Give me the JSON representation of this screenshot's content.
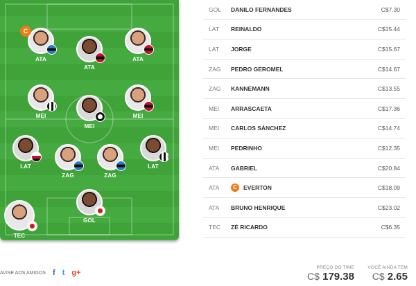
{
  "field": {
    "captain_marker": "C",
    "players": [
      {
        "pos": "ATA",
        "club": "gremio",
        "skin": "light"
      },
      {
        "pos": "ATA",
        "club": "flamengo",
        "skin": "dark"
      },
      {
        "pos": "ATA",
        "club": "flamengo",
        "skin": "light"
      },
      {
        "pos": "MEI",
        "club": "santos",
        "skin": "light"
      },
      {
        "pos": "MEI",
        "club": "corinthians",
        "skin": "dark"
      },
      {
        "pos": "MEI",
        "club": "flamengo",
        "skin": "light"
      },
      {
        "pos": "LAT",
        "club": "sao-paulo",
        "skin": "dark"
      },
      {
        "pos": "ZAG",
        "club": "gremio",
        "skin": "light"
      },
      {
        "pos": "ZAG",
        "club": "gremio",
        "skin": "light"
      },
      {
        "pos": "LAT",
        "club": "santos",
        "skin": "dark"
      },
      {
        "pos": "GOL",
        "club": "internacional",
        "skin": "dark"
      },
      {
        "pos": "TEC",
        "club": "internacional",
        "skin": "light"
      }
    ]
  },
  "roster": [
    {
      "pos": "GOL",
      "name": "DANILO FERNANDES",
      "price": "C$7.30",
      "captain": false
    },
    {
      "pos": "LAT",
      "name": "REINALDO",
      "price": "C$15.44",
      "captain": false
    },
    {
      "pos": "LAT",
      "name": "JORGE",
      "price": "C$15.67",
      "captain": false
    },
    {
      "pos": "ZAG",
      "name": "PEDRO GEROMEL",
      "price": "C$14.67",
      "captain": false
    },
    {
      "pos": "ZAG",
      "name": "KANNEMANN",
      "price": "C$13.55",
      "captain": false
    },
    {
      "pos": "MEI",
      "name": "ARRASCAETA",
      "price": "C$17.36",
      "captain": false
    },
    {
      "pos": "MEI",
      "name": "CARLOS SÁNCHEZ",
      "price": "C$14.74",
      "captain": false
    },
    {
      "pos": "MEI",
      "name": "PEDRINHO",
      "price": "C$12.35",
      "captain": false
    },
    {
      "pos": "ATA",
      "name": "GABRIEL",
      "price": "C$20.84",
      "captain": false
    },
    {
      "pos": "ATA",
      "name": "EVERTON",
      "price": "C$18.09",
      "captain": true
    },
    {
      "pos": "ATA",
      "name": "BRUNO HENRIQUE",
      "price": "C$23.02",
      "captain": false
    },
    {
      "pos": "TEC",
      "name": "ZÉ RICARDO",
      "price": "C$6.35",
      "captain": false
    }
  ],
  "footer": {
    "share_label": "AVISE AOS AMIGOS",
    "facebook_glyph": "f",
    "twitter_glyph": "t",
    "gplus_glyph": "g+",
    "team_price_label": "PREÇO DO TIME",
    "team_price_currency": "C$",
    "team_price_value": "179.38",
    "balance_label": "VOCÊ AINDA TEM",
    "balance_currency": "C$",
    "balance_value": "2.65"
  },
  "colors": {
    "pitch": "#3fa33a",
    "captain_badge": "#f07b16"
  }
}
